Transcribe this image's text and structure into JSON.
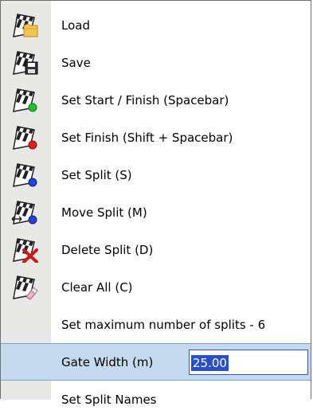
{
  "menu": {
    "items": [
      {
        "label": "Load",
        "icon": "load-folder-icon"
      },
      {
        "label": "Save",
        "icon": "save-disk-icon"
      },
      {
        "label": "Set Start / Finish (Spacebar)",
        "icon": "start-finish-flag-icon"
      },
      {
        "label": "Set Finish (Shift + Spacebar)",
        "icon": "finish-flag-icon"
      },
      {
        "label": "Set Split (S)",
        "icon": "split-flag-icon"
      },
      {
        "label": "Move Split (M)",
        "icon": "move-split-flag-icon"
      },
      {
        "label": "Delete Split (D)",
        "icon": "delete-split-flag-icon"
      },
      {
        "label": "Clear All (C)",
        "icon": "clear-all-flag-icon"
      },
      {
        "label": "Set maximum number of splits - 6"
      },
      {
        "label": "Gate Width (m)",
        "value": "25.00"
      },
      {
        "label": "Set Split Names"
      }
    ]
  },
  "colors": {
    "icon_column": "#e8e8e6",
    "highlight": "#c5d9ef",
    "selection": "#2a50c8",
    "green_marker": "#22c02a",
    "red_marker": "#e02020",
    "blue_marker": "#2244dd"
  }
}
